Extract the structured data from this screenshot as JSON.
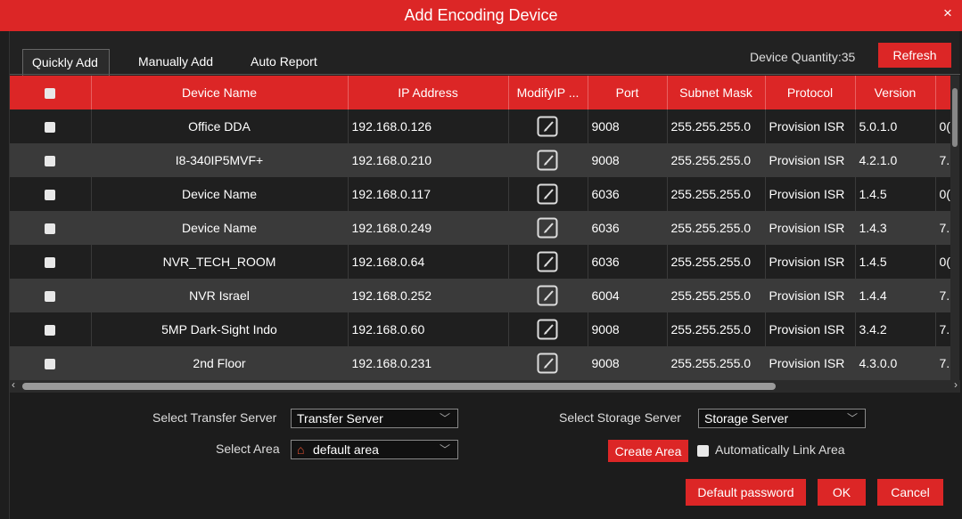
{
  "window": {
    "title": "Add Encoding Device",
    "close_glyph": "×"
  },
  "tabs": [
    {
      "label": "Quickly Add",
      "active": true
    },
    {
      "label": "Manually Add",
      "active": false
    },
    {
      "label": "Auto Report",
      "active": false
    }
  ],
  "device_quantity": "Device Quantity:35",
  "refresh_label": "Refresh",
  "table": {
    "headers": [
      "Device Name",
      "IP Address",
      "ModifyIP ...",
      "Port",
      "Subnet Mask",
      "Protocol",
      "Version"
    ],
    "rows": [
      {
        "name": "Office DDA",
        "ip": "192.168.0.126",
        "port": "9008",
        "mask": "255.255.255.0",
        "protocol": "Provision ISR",
        "version": "5.0.1.0",
        "extra": "0("
      },
      {
        "name": "I8-340IP5MVF+",
        "ip": "192.168.0.210",
        "port": "9008",
        "mask": "255.255.255.0",
        "protocol": "Provision ISR",
        "version": "4.2.1.0",
        "extra": "7."
      },
      {
        "name": "Device Name",
        "ip": "192.168.0.117",
        "port": "6036",
        "mask": "255.255.255.0",
        "protocol": "Provision ISR",
        "version": "1.4.5",
        "extra": "0("
      },
      {
        "name": "Device Name",
        "ip": "192.168.0.249",
        "port": "6036",
        "mask": "255.255.255.0",
        "protocol": "Provision ISR",
        "version": "1.4.3",
        "extra": "7."
      },
      {
        "name": "NVR_TECH_ROOM",
        "ip": "192.168.0.64",
        "port": "6036",
        "mask": "255.255.255.0",
        "protocol": "Provision ISR",
        "version": "1.4.5",
        "extra": "0("
      },
      {
        "name": "NVR Israel",
        "ip": "192.168.0.252",
        "port": "6004",
        "mask": "255.255.255.0",
        "protocol": "Provision ISR",
        "version": "1.4.4",
        "extra": "7."
      },
      {
        "name": "5MP Dark-Sight Indo",
        "ip": "192.168.0.60",
        "port": "9008",
        "mask": "255.255.255.0",
        "protocol": "Provision ISR",
        "version": "3.4.2",
        "extra": "7."
      },
      {
        "name": "2nd Floor",
        "ip": "192.168.0.231",
        "port": "9008",
        "mask": "255.255.255.0",
        "protocol": "Provision ISR",
        "version": "4.3.0.0",
        "extra": "7."
      }
    ]
  },
  "form": {
    "transfer_label": "Select Transfer Server",
    "transfer_value": "Transfer Server",
    "storage_label": "Select Storage Server",
    "storage_value": "Storage Server",
    "area_label": "Select Area",
    "area_value": "default area",
    "create_area_label": "Create Area",
    "auto_link_label": "Automatically Link Area"
  },
  "buttons": {
    "default_password": "Default password",
    "ok": "OK",
    "cancel": "Cancel"
  },
  "colors": {
    "accent": "#dc2626",
    "row_dark": "#1f1f1f",
    "row_light": "#3a3a3a"
  }
}
